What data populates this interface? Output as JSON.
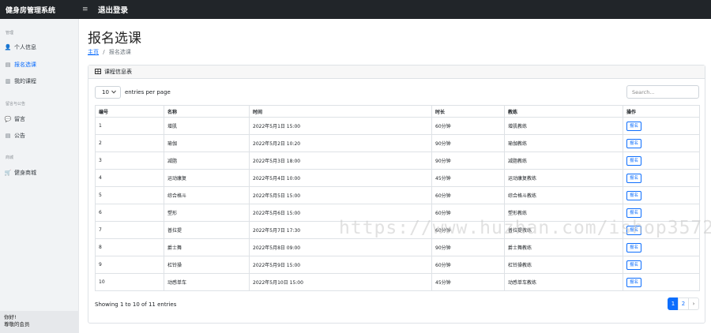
{
  "header": {
    "brand": "健身房管理系统",
    "menu_icon": "≡",
    "logout": "退出登录"
  },
  "sidebar": {
    "sections": [
      {
        "heading": "管理",
        "items": [
          {
            "label": "个人信息",
            "icon": "user-icon",
            "glyph": "👤"
          },
          {
            "label": "报名选课",
            "icon": "list-icon",
            "glyph": "▤"
          },
          {
            "label": "我的课程",
            "icon": "book-icon",
            "glyph": "▥"
          }
        ]
      },
      {
        "heading": "留言与公告",
        "items": [
          {
            "label": "留言",
            "icon": "comment-icon",
            "glyph": "💬"
          },
          {
            "label": "公告",
            "icon": "notice-icon",
            "glyph": "▤"
          }
        ]
      },
      {
        "heading": "商城",
        "items": [
          {
            "label": "健身商城",
            "icon": "cart-icon",
            "glyph": "🛒"
          }
        ]
      }
    ],
    "footer_line1": "你好!",
    "footer_line2": "尊敬的会员"
  },
  "main": {
    "title": "报名选课",
    "breadcrumb_home": "主页",
    "breadcrumb_sep": "/",
    "breadcrumb_current": "报名选课"
  },
  "card": {
    "header": "课程信息表",
    "header_icon": "table-icon",
    "per_page_value": "10",
    "per_page_label": "entries per page",
    "search_placeholder": "Search...",
    "columns": [
      "编号",
      "名称",
      "时间",
      "时长",
      "教练",
      "操作"
    ],
    "rows": [
      {
        "id": "1",
        "name": "增肌",
        "time": "2022年5月1日 15:00",
        "duration": "60分钟",
        "coach": "增肌教练",
        "action": "报名"
      },
      {
        "id": "2",
        "name": "瑜伽",
        "time": "2022年5月2日 10:20",
        "duration": "90分钟",
        "coach": "瑜伽教练",
        "action": "报名"
      },
      {
        "id": "3",
        "name": "减脂",
        "time": "2022年5月3日 18:00",
        "duration": "90分钟",
        "coach": "减脂教练",
        "action": "报名"
      },
      {
        "id": "4",
        "name": "运动康复",
        "time": "2022年5月4日 10:00",
        "duration": "45分钟",
        "coach": "运动康复教练",
        "action": "报名"
      },
      {
        "id": "5",
        "name": "综合格斗",
        "time": "2022年5月5日 15:00",
        "duration": "60分钟",
        "coach": "综合格斗教练",
        "action": "报名"
      },
      {
        "id": "6",
        "name": "塑形",
        "time": "2022年5月6日 15:00",
        "duration": "60分钟",
        "coach": "塑形教练",
        "action": "报名"
      },
      {
        "id": "7",
        "name": "普拉提",
        "time": "2022年5月7日 17:30",
        "duration": "60分钟",
        "coach": "普拉提教练",
        "action": "报名"
      },
      {
        "id": "8",
        "name": "爵士舞",
        "time": "2022年5月8日 09:00",
        "duration": "90分钟",
        "coach": "爵士舞教练",
        "action": "报名"
      },
      {
        "id": "9",
        "name": "杠铃操",
        "time": "2022年5月9日 15:00",
        "duration": "60分钟",
        "coach": "杠铃操教练",
        "action": "报名"
      },
      {
        "id": "10",
        "name": "动感单车",
        "time": "2022年5月10日 15:00",
        "duration": "45分钟",
        "coach": "动感单车教练",
        "action": "报名"
      }
    ],
    "info": "Showing 1 to 10 of 11 entries",
    "pages": [
      "1",
      "2"
    ],
    "next": "›"
  },
  "watermark": "https://www.huzhan.com/ishop3572",
  "colors": {
    "accent": "#0d6efd",
    "topbar": "#212529"
  }
}
